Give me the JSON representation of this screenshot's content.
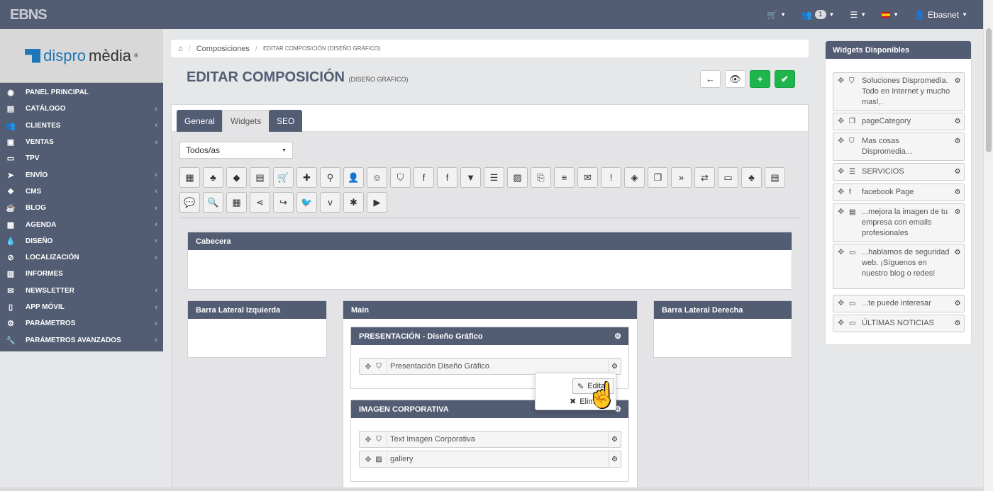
{
  "topbar": {
    "logo": "EBNS",
    "cart_icon": "cart-icon",
    "users_count": "1",
    "user_name": "Ebasnet"
  },
  "sidebar": {
    "brand": {
      "part1": "dispro",
      "part2": "mèdia",
      "reg": "®"
    },
    "items": [
      {
        "label": "PANEL PRINCIPAL",
        "icon": "dashboard-icon",
        "glyph": "◉",
        "arrow": false
      },
      {
        "label": "CATÁLOGO",
        "icon": "catalog-icon",
        "glyph": "▤",
        "arrow": true
      },
      {
        "label": "CLIENTES",
        "icon": "users-icon",
        "glyph": "👥",
        "arrow": true
      },
      {
        "label": "VENTAS",
        "icon": "money-icon",
        "glyph": "▣",
        "arrow": true
      },
      {
        "label": "TPV",
        "icon": "credit-card-icon",
        "glyph": "▭",
        "arrow": false
      },
      {
        "label": "ENVÍO",
        "icon": "send-icon",
        "glyph": "➤",
        "arrow": true
      },
      {
        "label": "CMS",
        "icon": "cubes-icon",
        "glyph": "❖",
        "arrow": true
      },
      {
        "label": "BLOG",
        "icon": "coffee-icon",
        "glyph": "☕",
        "arrow": true
      },
      {
        "label": "AGENDA",
        "icon": "calendar-icon",
        "glyph": "▦",
        "arrow": true
      },
      {
        "label": "DISEÑO",
        "icon": "tint-icon",
        "glyph": "💧",
        "arrow": true
      },
      {
        "label": "LOCALIZACIÓN",
        "icon": "compass-icon",
        "glyph": "⊘",
        "arrow": true
      },
      {
        "label": "INFORMES",
        "icon": "bar-chart-icon",
        "glyph": "▥",
        "arrow": false
      },
      {
        "label": "NEWSLETTER",
        "icon": "envelope-icon",
        "glyph": "✉",
        "arrow": true
      },
      {
        "label": "APP MÓVIL",
        "icon": "mobile-icon",
        "glyph": "▯",
        "arrow": true
      },
      {
        "label": "PARÁMETROS",
        "icon": "cogs-icon",
        "glyph": "⚙",
        "arrow": true
      },
      {
        "label": "PARÁMETROS AVANZADOS",
        "icon": "wrench-icon",
        "glyph": "🔧",
        "arrow": true
      }
    ]
  },
  "breadcrumb": {
    "section": "Composiciones",
    "current": "EDITAR COMPOSICIÓN (DISEÑO GRÁFICO)"
  },
  "page": {
    "title": "EDITAR COMPOSICIÓN",
    "subtitle": "(DISEÑO GRÁFICO)"
  },
  "tabs": [
    "General",
    "Widgets",
    "SEO"
  ],
  "filter": {
    "selected": "Todos/as"
  },
  "icon_buttons_row1": [
    "calendar-icon",
    "sitemap-icon",
    "tag-icon",
    "newspaper-icon",
    "cart-icon",
    "puzzle-icon",
    "map-marker-icon",
    "user-icon",
    "smile-icon",
    "html5-icon",
    "facebook-icon",
    "facebook-icon",
    "filter-icon",
    "list-icon",
    "image-icon",
    "code-file-icon",
    "list-ul-icon",
    "envelope-icon",
    "exclamation-icon",
    "tags-icon",
    "copy-icon",
    "double-chevron-icon",
    "exchange-icon",
    "folder-icon",
    "sitemap-icon",
    "newspaper-icon"
  ],
  "icon_buttons_row2": [
    "comments-icon",
    "search-icon",
    "calculator-icon",
    "share-icon",
    "forward-icon",
    "twitter-icon",
    "vimeo-icon",
    "asterisk-icon",
    "youtube-icon"
  ],
  "layout": {
    "header": "Cabecera",
    "left": "Barra Lateral Izquierda",
    "main": "Main",
    "right": "Barra Lateral Derecha",
    "section1": {
      "title": "PRESENTACIÓN - Diseño Gráfico",
      "widget": "Presentación Diseño Gráfico"
    },
    "section2": {
      "title": "IMAGEN CORPORATIVA",
      "widgets": [
        "Text Imagen Corporativa",
        "gallery"
      ]
    }
  },
  "context_menu": {
    "edit": "Editar",
    "delete": "Eliminar"
  },
  "available": {
    "title": "Widgets Disponibles",
    "items": [
      {
        "text": "Soluciones Dispromedia. Todo en Internet y mucho mas!,.",
        "icon": "html5-icon"
      },
      {
        "text": "pageCategory",
        "icon": "copy-icon"
      },
      {
        "text": "Mas cosas Dispromedia...",
        "icon": "html5-icon"
      },
      {
        "text": "SERVICIOS",
        "icon": "list-icon"
      },
      {
        "text": "facebook Page",
        "icon": "facebook-icon"
      },
      {
        "text": "...mejora la imagen de tu empresa con emails profesionales",
        "icon": "newspaper-icon"
      },
      {
        "text": "...hablamos de seguridad web. ¡Síguenos en nuestro blog o redes!",
        "icon": "folder-icon"
      },
      {
        "text": "...te puede interesar",
        "icon": "folder-icon"
      },
      {
        "text": "ÚLTIMAS NOTICIAS",
        "icon": "folder-icon"
      }
    ]
  }
}
